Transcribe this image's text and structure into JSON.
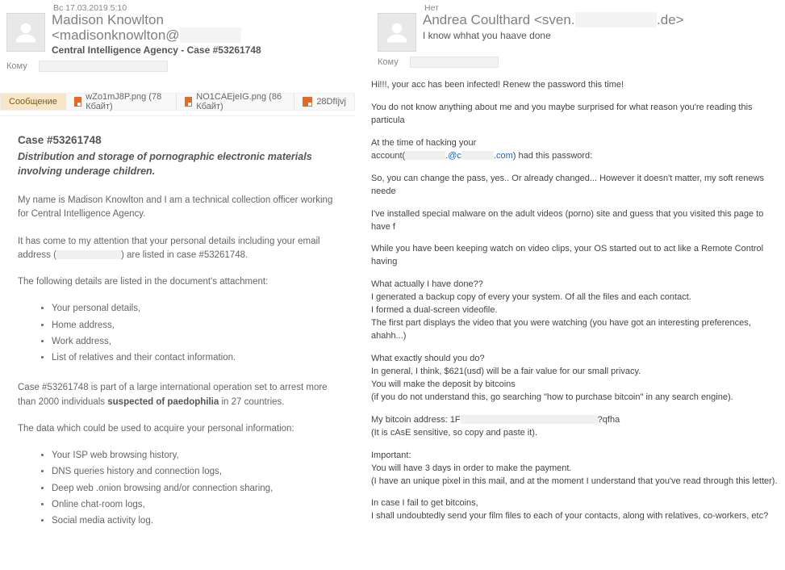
{
  "left": {
    "date": "Вс 17.03.2019 5:10",
    "from_display": "Madison Knowlton <madisonknowlton@",
    "from_tail": ">",
    "subject": "Central Intelligence Agency - Case #53261748",
    "to_label": "Кому",
    "attachments": {
      "msg_tab": "Сообщение",
      "a1": "wZo1mJ8P.png (78 Кбайт)",
      "a2": "NO1CAEjeIG.png (86 Кбайт)",
      "a3": "28DfIjvj"
    },
    "body": {
      "case_heading": "Case #53261748",
      "subhead": "Distribution and storage of pornographic electronic materials involving underage children.",
      "p1": "My name is Madison Knowlton and I am a technical collection officer working for Central Intelligence Agency.",
      "p2a": "It has come to my attention that your personal details including your email address (",
      "p2b": ") are listed in case #53261748.",
      "p3": "The following details are listed in the document's attachment:",
      "list1": [
        "Your personal details,",
        "Home address,",
        "Work address,",
        "List of relatives and their contact information."
      ],
      "p4a": "Case #53261748 is part of a large international operation set to arrest more than 2000 individuals ",
      "p4b": "suspected of paedophilia",
      "p4c": " in 27 countries.",
      "p5": "The data which could be used to acquire your personal information:",
      "list2": [
        "Your ISP web browsing history,",
        "DNS queries history and connection logs,",
        "Deep web .onion browsing and/or connection sharing,",
        "Online chat-room logs,",
        "Social media activity log."
      ]
    }
  },
  "right": {
    "date": "Нет",
    "from_display": "Andrea Coulthard <sven.",
    "from_mid_redact": "        ",
    "from_tail": ".de>",
    "subject": "I know whhat you haave done",
    "to_label": "Кому",
    "body": {
      "p1": "Hi!!!, your acc has been infected! Renew the password this time!",
      "p2": "You do not know anything about me and you maybe surprised for what reason you're reading this particula",
      "p3a": "At the time of hacking your",
      "p3b": "account(",
      "p3c": ") had this password:",
      "acct_mid": ".@c",
      "acct_tail": ".com",
      "p4": "So, you can change the pass, yes.. Or already changed... However it doesn't matter, my soft renews neede",
      "p5": "I've installed special malware on the adult videos (porno) site and guess that you visited this page to have f",
      "p6": "While you have been keeping watch on video clips, your OS started out to act like a Remote Control having",
      "p7": "What actually I have done??",
      "p8": "I generated a backup copy of every your system. Of all the files and each contact.",
      "p9": "I formed a dual-screen videofile.",
      "p10": "The first part displays the video that you were watching (you have got an interesting preferences, ahahh...)",
      "p11": "What exactly should you do?",
      "p12": "In general, I think, $621(usd) will be a fair value for our small privacy.",
      "p13": "You will make the deposit by bitcoins",
      "p14": "(if you do not understand this, go searching \"how to purchase bitcoin\" in any search engine).",
      "p15a": "My bitcoin   address: 1F",
      "p15b": "?qfha",
      "p16": "(It is cAsE sensitive, so copy and paste it).",
      "p17": "Important:",
      "p18": "You will have 3 days in order to make the payment.",
      "p19": "(I have an unique pixel in this mail, and at the moment I understand that you've read through this letter).",
      "p20": "In case I fail to get bitcoins,",
      "p21": "I shall undoubtedly send your film files to each of your contacts, along with relatives, co-workers, etc?"
    }
  }
}
